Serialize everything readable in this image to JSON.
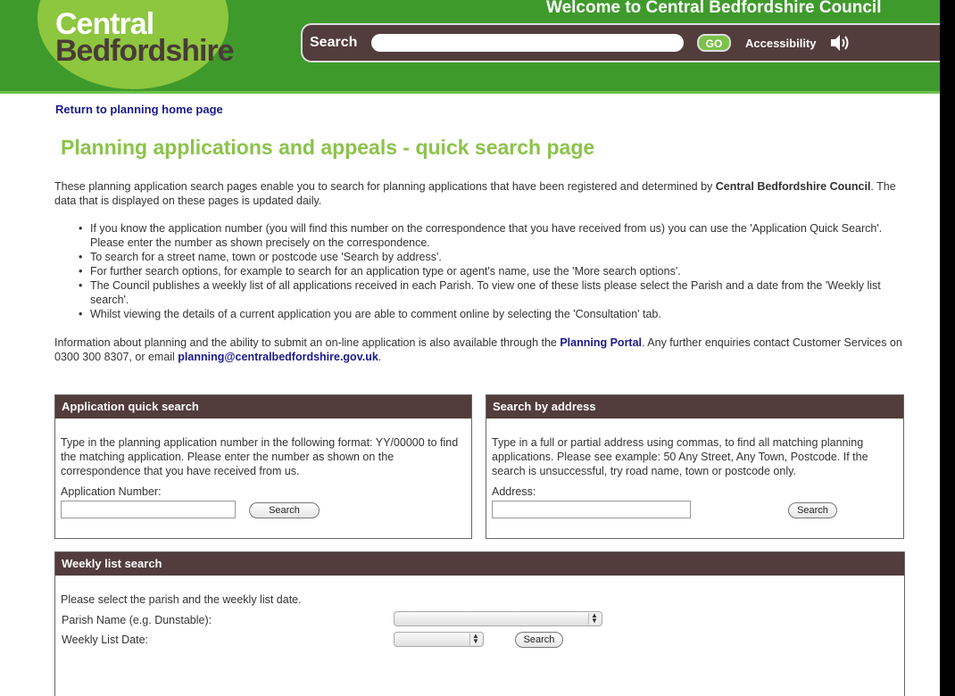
{
  "header": {
    "logo_line1": "Central",
    "logo_line2": "Bedfordshire",
    "welcome": "Welcome to Central Bedfordshire Council",
    "search_label": "Search",
    "go_label": "GO",
    "accessibility": "Accessibility",
    "speaker_icon": "speaker-icon"
  },
  "nav": {
    "return_link": "Return to planning home page"
  },
  "page_title": "Planning applications and appeals - quick search page",
  "intro": {
    "before": "These planning application search pages enable you to search for planning applications that have been registered and determined by ",
    "bold": "Central Bedfordshire Council",
    "after": ". The data that is displayed on these pages is updated daily."
  },
  "bullets": [
    "If you know the application number (you will find this number on the correspondence that you have received from us) you can use the 'Application Quick Search'. Please enter the number as shown precisely on the correspondence.",
    "To search for a street name, town or postcode use 'Search by address'.",
    "For further search options, for example to search for an application type or agent's name, use the 'More search options'.",
    "The Council publishes a weekly list of all applications received in each Parish. To view one of these lists please select the Parish and a date from the 'Weekly list search'.",
    "Whilst viewing the details of a current application you are able to comment online by selecting the 'Consultation' tab."
  ],
  "info": {
    "part1": "Information about planning and the ability to submit an on-line application is also available through the ",
    "portal_link": "Planning Portal",
    "part2": ". Any further enquiries contact Customer Services on 0300 300 8307, or email ",
    "email_link": "planning@centralbedfordshire.gov.uk",
    "part3": "."
  },
  "quick_search": {
    "heading": "Application quick search",
    "text": "Type in the planning application number in the following format: YY/00000 to find the matching application. Please enter the number as shown on the correspondence that you have received from us.",
    "field_label": "Application Number:",
    "field_value": "",
    "button": "Search"
  },
  "address_search": {
    "heading": "Search by address",
    "text": "Type in a full or partial address using commas, to find all matching planning applications. Please see example: 50 Any Street, Any Town, Postcode. If the search is unsuccessful, try road name, town or postcode only.",
    "field_label": "Address:",
    "field_value": "",
    "button": "Search"
  },
  "weekly_search": {
    "heading": "Weekly list search",
    "text": "Please select the parish and the weekly list date.",
    "parish_label": "Parish Name (e.g. Dunstable):",
    "parish_value": "",
    "date_label": "Weekly List Date:",
    "date_value": "",
    "button": "Search"
  },
  "colors": {
    "header_green": "#3f9a2c",
    "logo_green": "#8dc63f",
    "panel_brown": "#523c3c",
    "title_green": "#8bc34a",
    "link_blue": "#1a1a8c"
  }
}
